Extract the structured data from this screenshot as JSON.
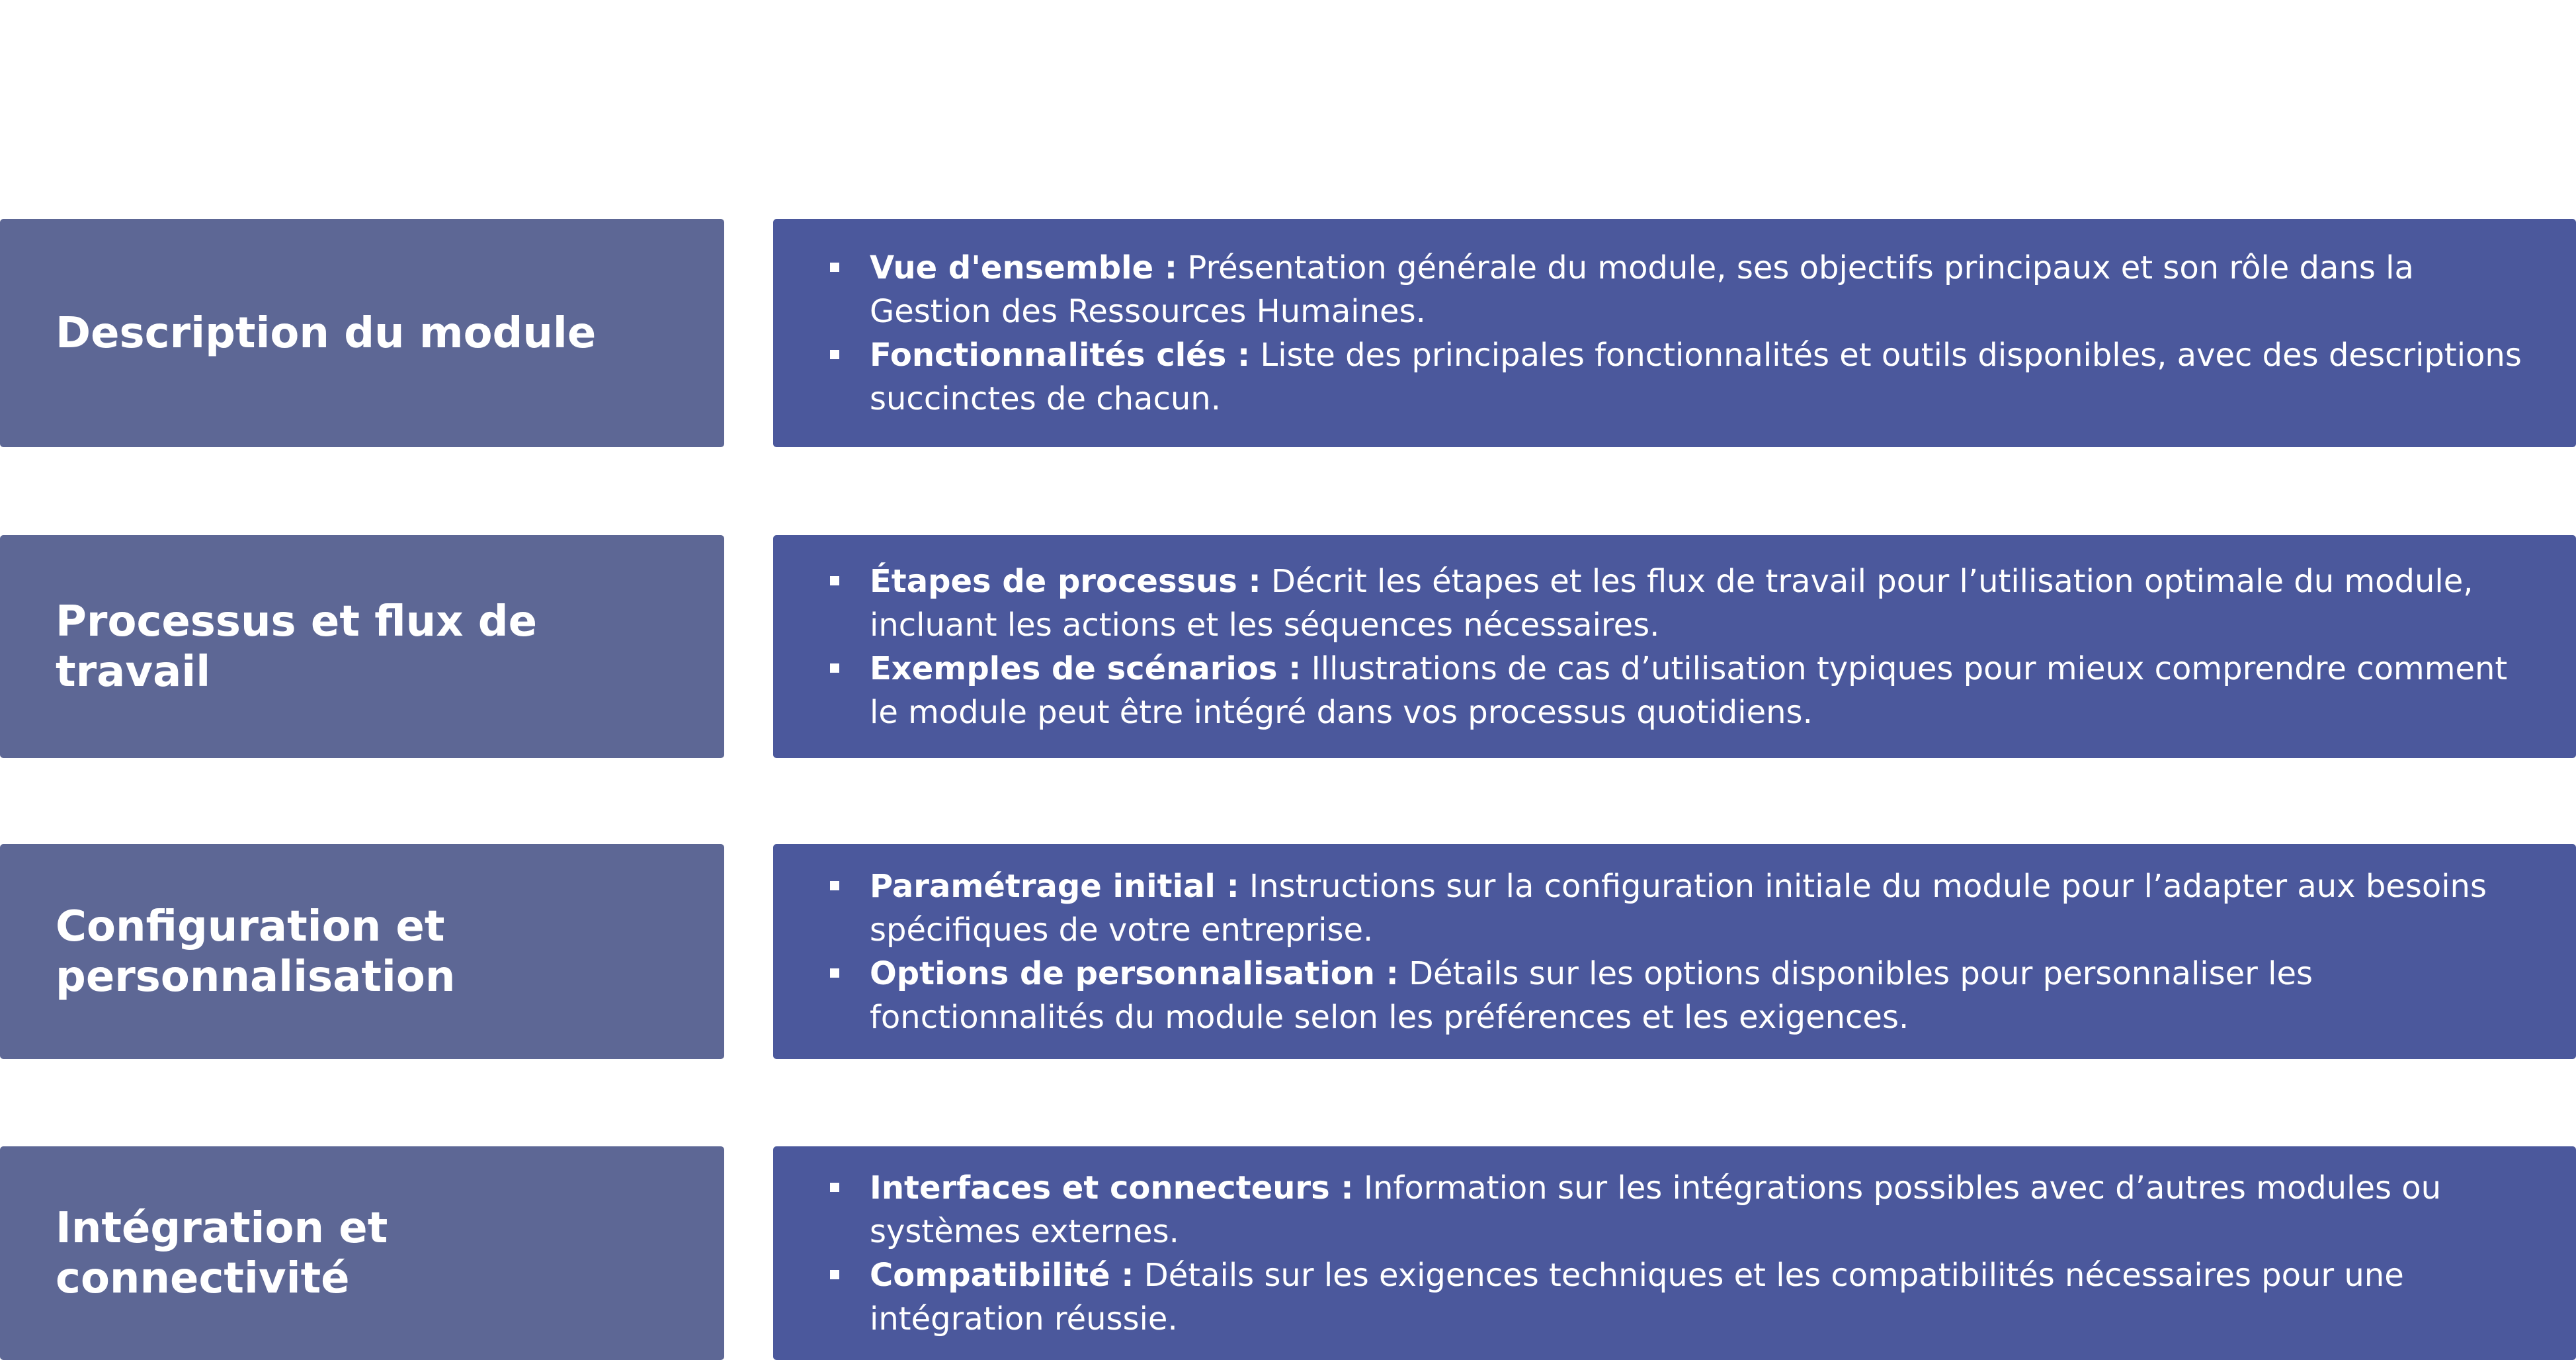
{
  "rows": [
    {
      "label": "Description du module",
      "bullets": [
        {
          "title": "Vue d'ensemble :",
          "text": " Présentation générale du module, ses objectifs principaux et son rôle dans la Gestion des Ressources Humaines."
        },
        {
          "title": "Fonctionnalités clés :",
          "text": " Liste des principales fonctionnalités et outils disponibles, avec des descriptions succinctes de chacun."
        }
      ]
    },
    {
      "label": "Processus et flux de travail",
      "bullets": [
        {
          "title": "Étapes de processus :",
          "text": " Décrit les étapes et les flux de travail pour l’utilisation optimale du module, incluant les actions et les séquences nécessaires."
        },
        {
          "title": "Exemples de scénarios :",
          "text": " Illustrations de cas d’utilisation typiques pour mieux comprendre comment le module peut être intégré dans vos processus quotidiens."
        }
      ]
    },
    {
      "label": "Configuration et personnalisation",
      "bullets": [
        {
          "title": "Paramétrage initial :",
          "text": " Instructions sur la configuration initiale du module pour l’adapter aux besoins spécifiques de votre entreprise."
        },
        {
          "title": "Options de personnalisation :",
          "text": " Détails sur les options disponibles pour personnaliser les fonctionnalités du module selon les préférences et les exigences."
        }
      ]
    },
    {
      "label": "Intégration et connectivité",
      "bullets": [
        {
          "title": "Interfaces et connecteurs :",
          "text": " Information sur les intégrations possibles avec d’autres modules ou systèmes externes."
        },
        {
          "title": "Compatibilité :",
          "text": " Détails sur les exigences techniques et les compatibilités nécessaires pour une intégration réussie."
        }
      ]
    }
  ]
}
